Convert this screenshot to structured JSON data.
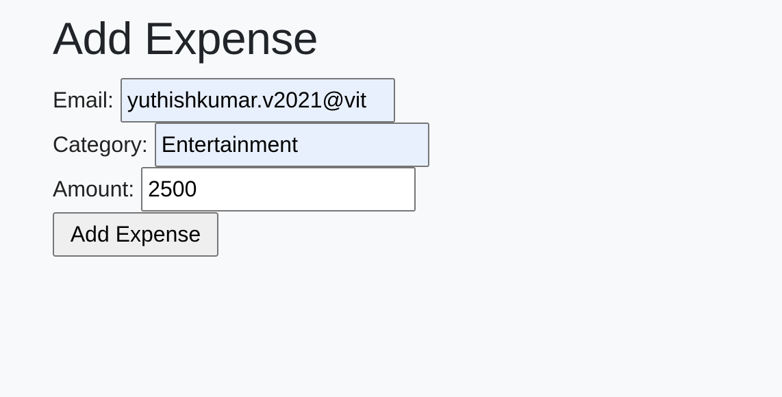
{
  "page": {
    "title": "Add Expense"
  },
  "form": {
    "email": {
      "label": "Email:",
      "value": "yuthishkumar.v2021@vit"
    },
    "category": {
      "label": "Category:",
      "value": "Entertainment"
    },
    "amount": {
      "label": "Amount:",
      "value": "2500"
    },
    "submit_label": "Add Expense"
  },
  "colors": {
    "background": "#f8f9fb",
    "autofill_background": "#e8f0fe",
    "input_border": "#767676",
    "button_background": "#efefef",
    "heading_text": "#212529"
  }
}
